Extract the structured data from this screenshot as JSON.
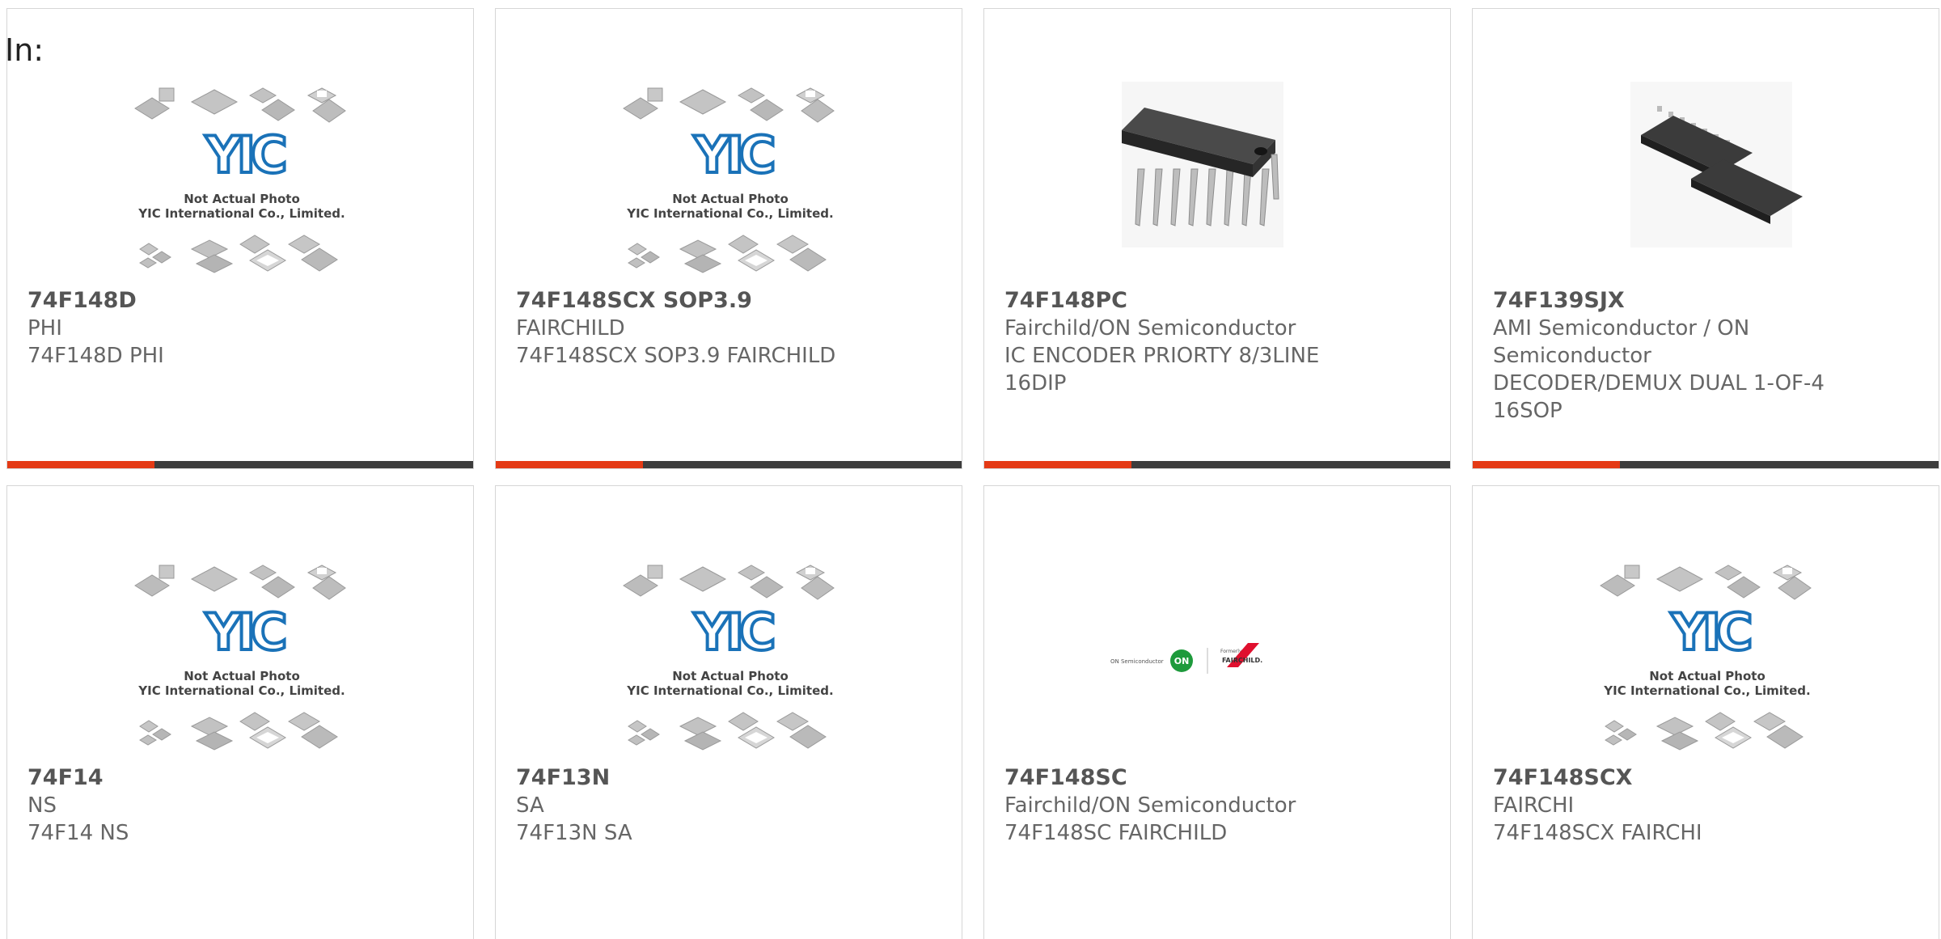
{
  "header": {
    "in_label": "In:"
  },
  "placeholder": {
    "logo_text": "YIC",
    "line1": "Not Actual Photo",
    "line2": "YIC International Co., Limited."
  },
  "brand_strip": {
    "on_text": "ON Semiconductor",
    "on_badge": "ON",
    "formerly": "Formerly",
    "fairchild": "FAIRCHILD."
  },
  "colors": {
    "accent_red": "#e43a15",
    "accent_dark": "#3d3d3d",
    "logo_blue": "#1a72b8"
  },
  "products": [
    {
      "part": "74F148D",
      "maker": "PHI",
      "desc": "74F148D PHI",
      "image": "placeholder"
    },
    {
      "part": "74F148SCX SOP3.9",
      "maker": "FAIRCHILD",
      "desc": "74F148SCX SOP3.9 FAIRCHILD",
      "image": "placeholder"
    },
    {
      "part": "74F148PC",
      "maker": "Fairchild/ON Semiconductor",
      "desc": "IC ENCODER PRIORTY 8/3LINE 16DIP",
      "image": "dip-chip"
    },
    {
      "part": "74F139SJX",
      "maker": "AMI Semiconductor / ON Semiconductor",
      "desc": "DECODER/DEMUX DUAL 1-OF-4 16SOP",
      "image": "sop-chip"
    },
    {
      "part": "74F14",
      "maker": "NS",
      "desc": "74F14 NS",
      "image": "placeholder"
    },
    {
      "part": "74F13N",
      "maker": "SA",
      "desc": "74F13N SA",
      "image": "placeholder"
    },
    {
      "part": "74F148SC",
      "maker": "Fairchild/ON Semiconductor",
      "desc": "74F148SC FAIRCHILD",
      "image": "brand-logo"
    },
    {
      "part": "74F148SCX",
      "maker": "FAIRCHI",
      "desc": "74F148SCX FAIRCHI",
      "image": "placeholder"
    }
  ]
}
